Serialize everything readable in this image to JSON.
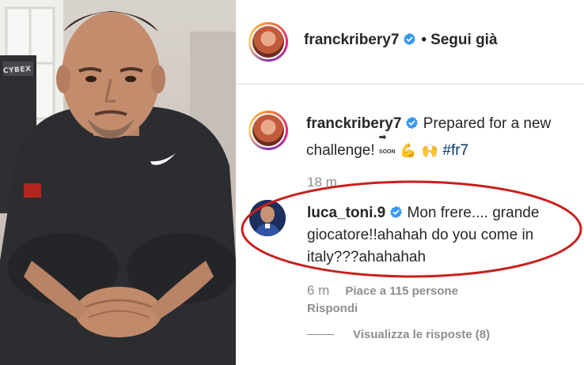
{
  "photo": {
    "equipment_label": "CYBEX"
  },
  "header": {
    "username": "franckribery7",
    "separator": "•",
    "follow_status": "Segui già"
  },
  "caption": {
    "username": "franckribery7",
    "text": "Prepared for a new challenge!",
    "soon_icon": "SOON",
    "emojis": [
      "💪",
      "🙌"
    ],
    "hashtag": "#fr7",
    "time": "18 m"
  },
  "comment": {
    "username": "luca_toni.9",
    "text": "Mon frere.... grande giocatore!!ahahah do you come in italy???ahahahah",
    "time": "6 m",
    "likes": "Piace a 115 persone",
    "reply_label": "Rispondi"
  },
  "view_replies": "Visualizza le risposte (8)",
  "colors": {
    "highlight_ellipse": "#c8201e",
    "verified_badge": "#3897f0",
    "hashtag": "#00376b",
    "muted_text": "#8e8e8e"
  },
  "icons": [
    "verified-badge-icon",
    "soon-arrow-icon",
    "flexed-biceps-emoji",
    "raising-hands-emoji"
  ]
}
